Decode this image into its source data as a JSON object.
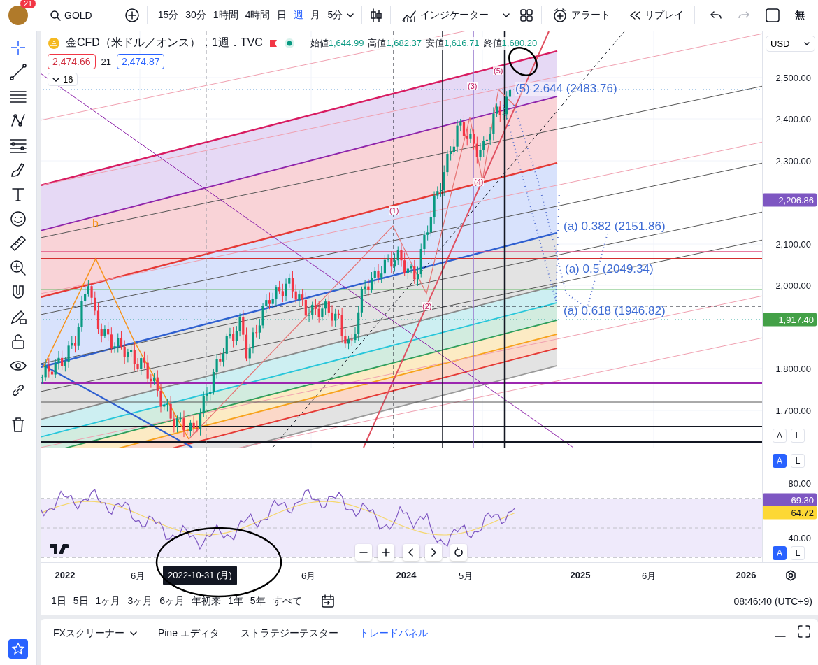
{
  "header": {
    "notification_count": "21",
    "symbol": "GOLD",
    "timeframes": [
      {
        "label": "15分",
        "selected": false
      },
      {
        "label": "30分",
        "selected": false
      },
      {
        "label": "1時間",
        "selected": false
      },
      {
        "label": "4時間",
        "selected": false
      },
      {
        "label": "日",
        "selected": false
      },
      {
        "label": "週",
        "selected": true
      },
      {
        "label": "月",
        "selected": false
      },
      {
        "label": "5分",
        "selected": false
      }
    ],
    "indicators": "インジケーター",
    "alert": "アラート",
    "replay": "リプレイ",
    "layout_name": "無"
  },
  "legend": {
    "title": "金CFD（米ドル／オンス）．1週．TVC",
    "ohlc": [
      {
        "label": "始値",
        "value": "1,644.99"
      },
      {
        "label": "高値",
        "value": "1,682.37"
      },
      {
        "label": "安値",
        "value": "1,616.71"
      },
      {
        "label": "終値",
        "value": "1,680.20"
      }
    ],
    "sell": "2,474.66",
    "spread": "21",
    "buy": "2,474.87",
    "indicator_count": "16"
  },
  "chart_labels": [
    {
      "text": "(5) 2.644 (2483.76)",
      "kind": "fib"
    },
    {
      "text": "(a) 0.382 (2151.86)",
      "kind": "fib"
    },
    {
      "text": "(a) 0.5 (2049.34)",
      "kind": "fib"
    },
    {
      "text": "(a) 0.618 (1946.82)",
      "kind": "fib"
    },
    {
      "text": "b",
      "kind": "corrective"
    },
    {
      "text": "(5)",
      "kind": "wave"
    },
    {
      "text": "(3)",
      "kind": "wave"
    },
    {
      "text": "(4)",
      "kind": "wave"
    },
    {
      "text": "(1)",
      "kind": "wave"
    },
    {
      "text": "(2)",
      "kind": "wave"
    }
  ],
  "price_axis": {
    "currency": "USD",
    "ticks": [
      "2,500.00",
      "2,400.00",
      "2,300.00",
      "2,100.00",
      "2,000.00",
      "1,800.00",
      "1,700.00"
    ],
    "badges": [
      {
        "value": "2,206.86",
        "color": "#7e57c2"
      },
      {
        "value": "1,917.40",
        "color": "#43a047"
      }
    ],
    "scale_buttons": [
      {
        "label": "A",
        "selected": false
      },
      {
        "label": "L",
        "selected": false
      }
    ]
  },
  "rsi": {
    "ticks": [
      "80.00",
      "40.00"
    ],
    "badges": [
      {
        "value": "69.30",
        "color": "#7e57c2"
      },
      {
        "value": "64.72",
        "color": "#fdd835"
      }
    ],
    "top_scale_buttons": [
      {
        "label": "A",
        "selected": true
      },
      {
        "label": "L",
        "selected": false
      }
    ],
    "scale_buttons": [
      {
        "label": "A",
        "selected": true
      },
      {
        "label": "L",
        "selected": false
      }
    ]
  },
  "time_axis": {
    "labels": [
      "2022",
      "6月",
      "6月",
      "2024",
      "5月",
      "2025",
      "6月",
      "2026"
    ],
    "cursor_label": "2022-10-31 (月)"
  },
  "ranges": [
    "1日",
    "5日",
    "1ヶ月",
    "3ヶ月",
    "6ヶ月",
    "年初来",
    "1年",
    "5年",
    "すべて"
  ],
  "clock": "08:46:40 (UTC+9)",
  "bottom_tabs": [
    {
      "label": "FXスクリーナー",
      "selected": false,
      "dropdown": true
    },
    {
      "label": "Pine エディタ",
      "selected": false,
      "dropdown": false
    },
    {
      "label": "ストラテジーテスター",
      "selected": false,
      "dropdown": false
    },
    {
      "label": "トレードパネル",
      "selected": true,
      "dropdown": false
    }
  ]
}
